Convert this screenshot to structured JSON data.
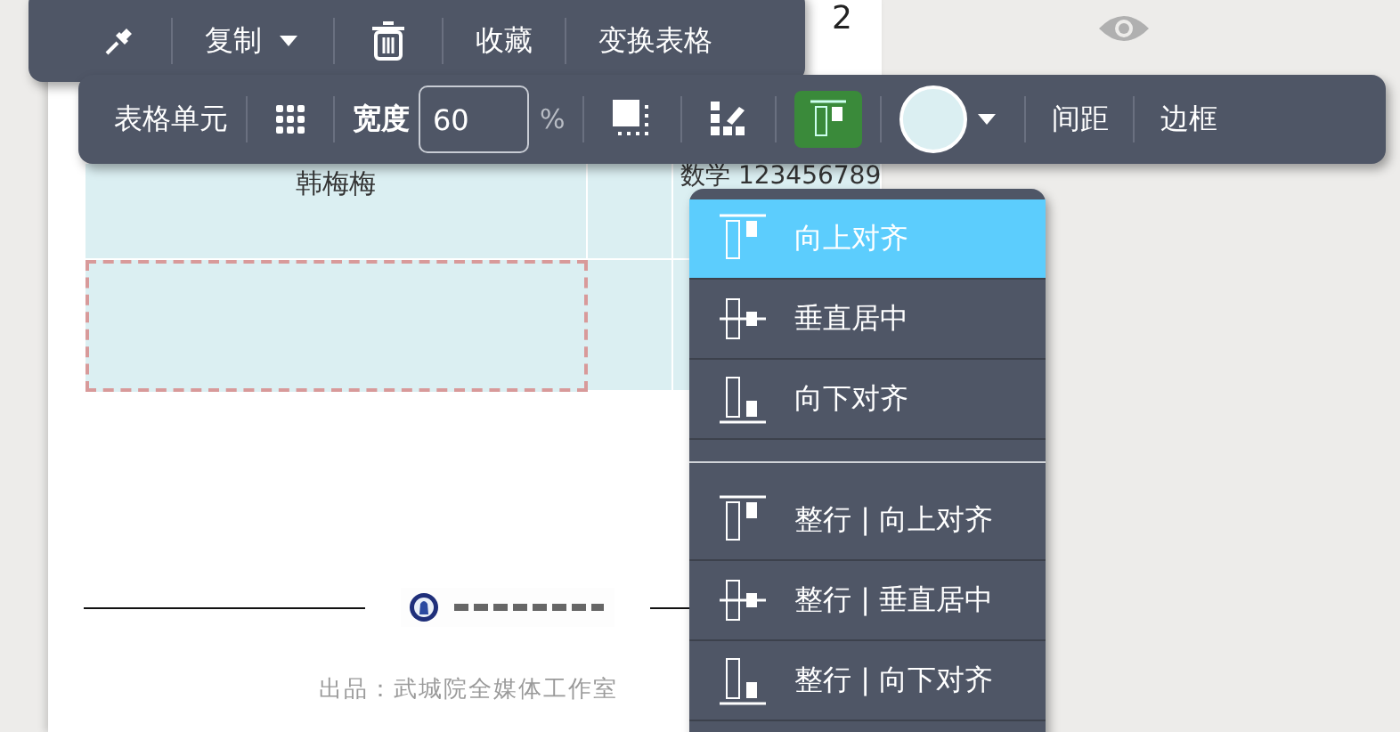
{
  "document": {
    "row_above": {
      "text": "2"
    },
    "table": {
      "rows": [
        {
          "cells": [
            {
              "text": "韩梅梅",
              "selected": false
            },
            {
              "selected": false
            },
            {
              "text": "数学 123456789",
              "selected": false
            }
          ]
        },
        {
          "cells": [
            {
              "selected": true
            },
            {
              "selected": false
            },
            {
              "selected": false
            }
          ]
        }
      ]
    },
    "credit": "出品：武城院全媒体工作室"
  },
  "top_toolbar": {
    "copy_label": "复制",
    "buttons": [
      "收藏",
      "变换表格"
    ]
  },
  "cell_toolbar": {
    "title": "表格单元",
    "width_label": "宽度",
    "width_value": "60",
    "unit": "%",
    "align_button": {
      "selected": true
    },
    "buttons": [
      "间距",
      "边框"
    ]
  },
  "align_menu": {
    "groups": [
      {
        "items": [
          {
            "label": "向上对齐",
            "kind": "top",
            "selected": true
          },
          {
            "label": "垂直居中",
            "kind": "middle",
            "selected": false
          },
          {
            "label": "向下对齐",
            "kind": "bottom",
            "selected": false
          }
        ]
      },
      {
        "items": [
          {
            "label": "整行 | 向上对齐",
            "kind": "top",
            "selected": false
          },
          {
            "label": "整行 | 垂直居中",
            "kind": "middle",
            "selected": false
          },
          {
            "label": "整行 | 向下对齐",
            "kind": "bottom",
            "selected": false
          }
        ]
      }
    ]
  }
}
